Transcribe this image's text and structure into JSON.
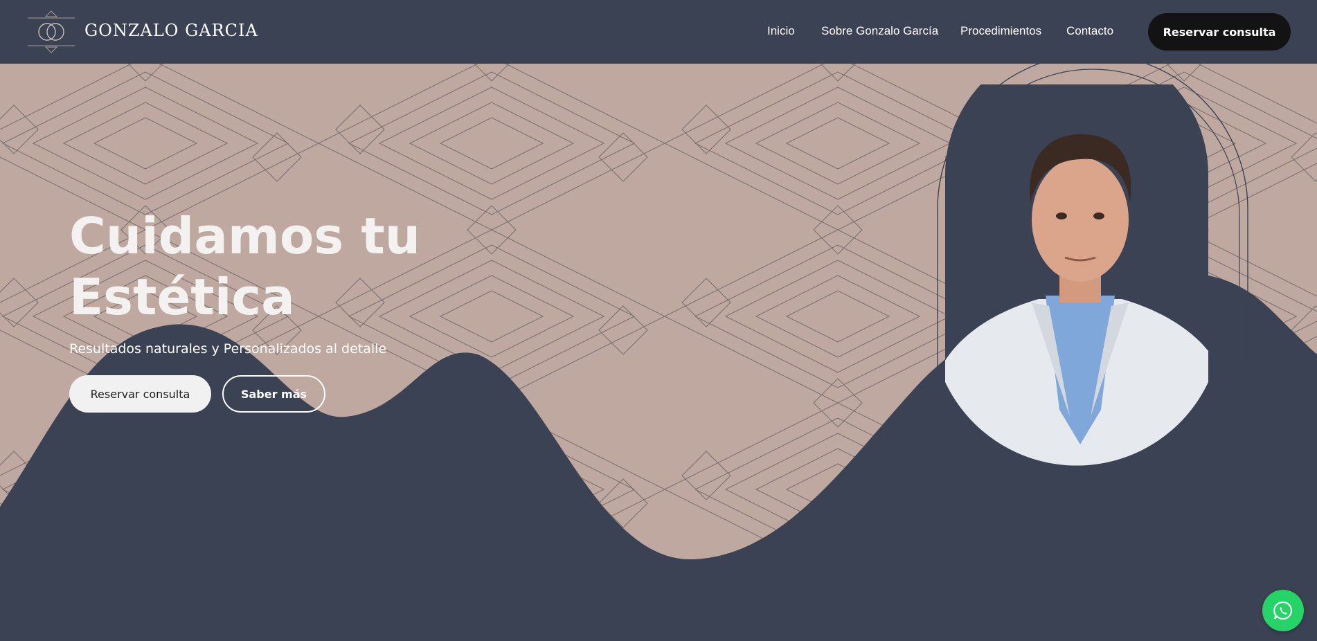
{
  "brand": {
    "name": "GONZALO GARCIA",
    "logo_icon": "gg-monogram-icon"
  },
  "nav": {
    "items": [
      {
        "label": "Inicio"
      },
      {
        "label": "Sobre Gonzalo García"
      },
      {
        "label": "Procedimientos"
      },
      {
        "label": "Contacto"
      }
    ],
    "cta_label": "Reservar consulta"
  },
  "hero": {
    "title_line1": "Cuidamos tu",
    "title_line2": "Estética",
    "subtitle": "Resultados naturales y Personalizados al detalle",
    "primary_button": "Reservar consulta",
    "secondary_button": "Saber más",
    "portrait": "doctor-portrait"
  },
  "floating": {
    "icon": "whatsapp-icon"
  },
  "colors": {
    "navy": "#3b4253",
    "sand": "#bfa89f",
    "pattern_line": "#6f6566",
    "cta_dark": "#131313",
    "whatsapp": "#25d366"
  }
}
